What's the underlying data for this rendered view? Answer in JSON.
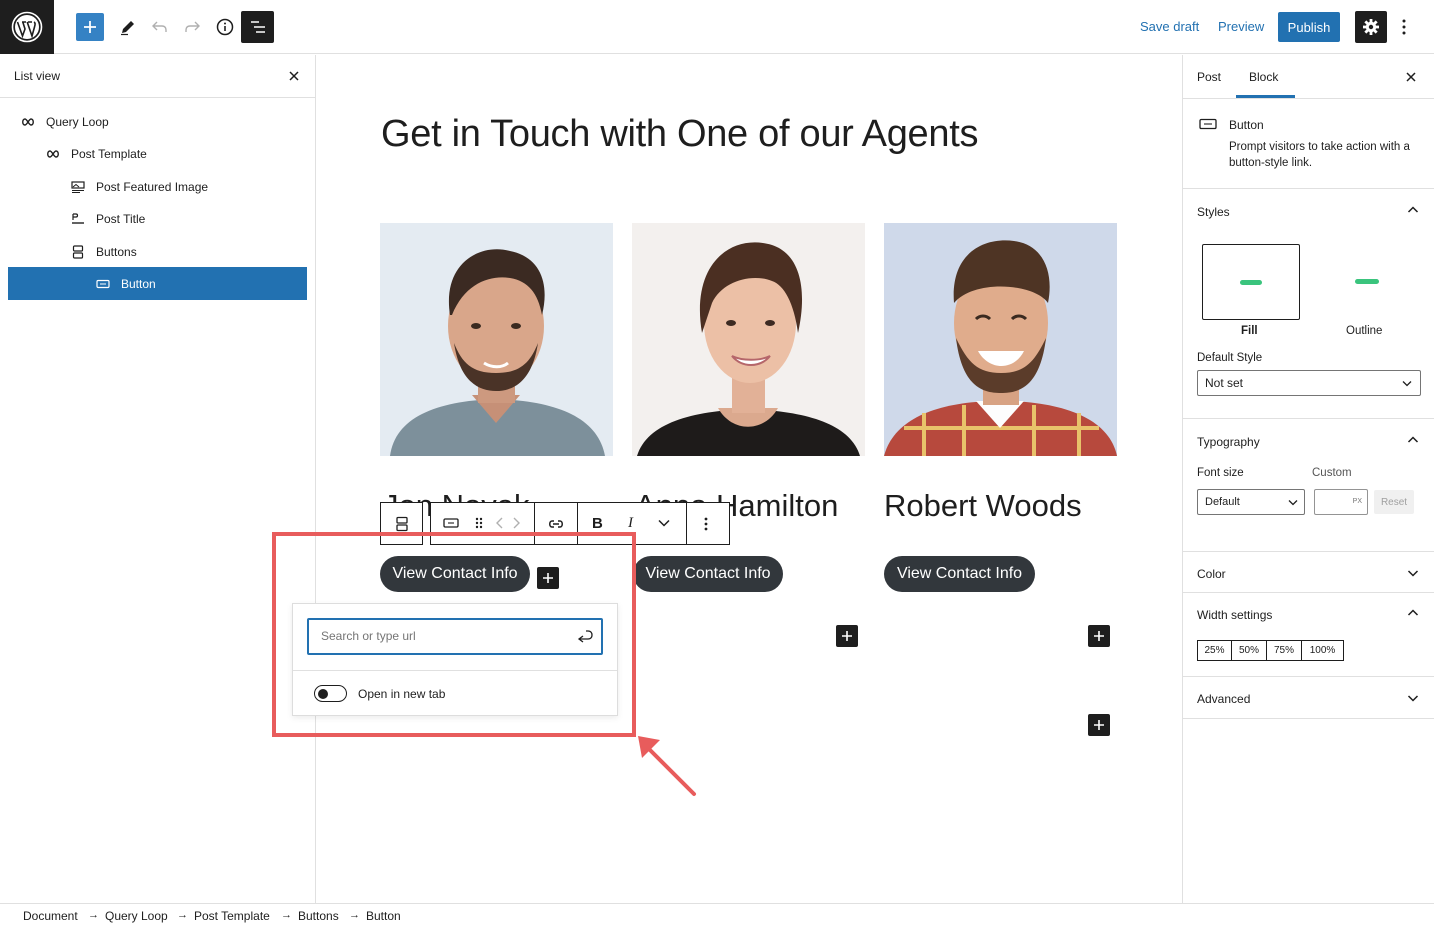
{
  "topbar": {
    "save_draft": "Save draft",
    "preview": "Preview",
    "publish": "Publish",
    "accent": "#2271b1"
  },
  "listview": {
    "title": "List view",
    "items": [
      {
        "label": "Query Loop",
        "icon": "loop-icon"
      },
      {
        "label": "Post Template",
        "icon": "loop-icon"
      },
      {
        "label": "Post Featured Image",
        "icon": "featured-image-icon"
      },
      {
        "label": "Post Title",
        "icon": "title-icon"
      },
      {
        "label": "Buttons",
        "icon": "buttons-icon"
      },
      {
        "label": "Button",
        "icon": "button-icon",
        "selected": true
      }
    ]
  },
  "canvas": {
    "title": "Get in Touch with One of our Agents",
    "agents": [
      {
        "name": "Jon Novak",
        "button": "View Contact Info"
      },
      {
        "name": "Anna Hamilton",
        "button": "View Contact Info"
      },
      {
        "name": "Robert Woods",
        "button": "View Contact Info"
      }
    ],
    "link_popover": {
      "placeholder": "Search or type url",
      "new_tab_label": "Open in new tab",
      "new_tab_checked": false
    }
  },
  "sidebar": {
    "tabs": [
      "Post",
      "Block"
    ],
    "active_tab": "Block",
    "block_name": "Button",
    "block_description": "Prompt visitors to take action with a button-style link.",
    "styles": {
      "heading": "Styles",
      "options": [
        "Fill",
        "Outline"
      ],
      "selected": "Fill",
      "default_style_label": "Default Style",
      "default_style_value": "Not set"
    },
    "typography": {
      "heading": "Typography",
      "font_size_label": "Font size",
      "custom_label": "Custom",
      "font_size_value": "Default",
      "unit": "PX",
      "reset": "Reset"
    },
    "color": {
      "heading": "Color"
    },
    "width_settings": {
      "heading": "Width settings",
      "options": [
        "25%",
        "50%",
        "75%",
        "100%"
      ]
    },
    "advanced": {
      "heading": "Advanced"
    }
  },
  "breadcrumb": [
    "Document",
    "Query Loop",
    "Post Template",
    "Buttons",
    "Button"
  ],
  "colors": {
    "button_dark": "#32373c",
    "annotation_red": "#e85c5c",
    "selected_row": "#2271b1"
  }
}
